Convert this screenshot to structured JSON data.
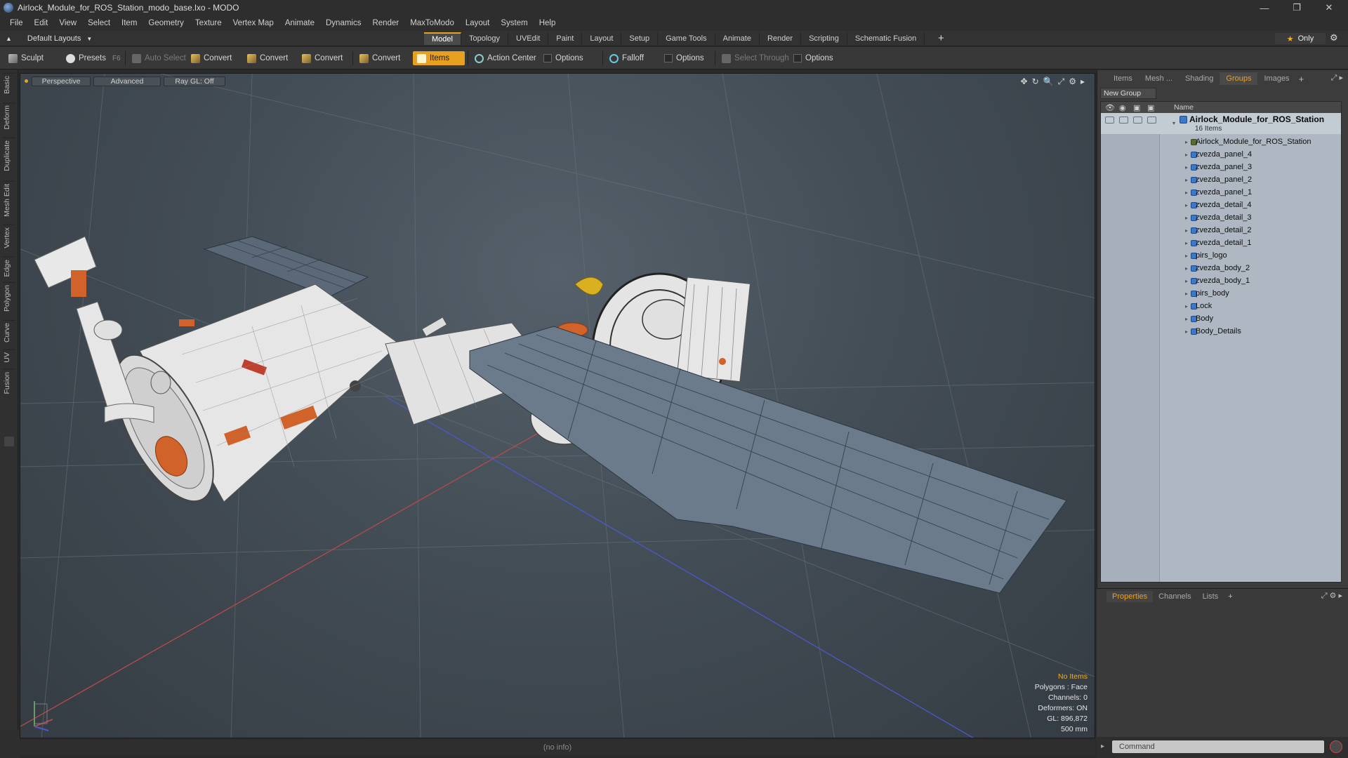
{
  "window": {
    "title": "Airlock_Module_for_ROS_Station_modo_base.lxo - MODO",
    "minimize": "—",
    "restore": "❐",
    "close": "✕"
  },
  "menu": [
    "File",
    "Edit",
    "View",
    "Select",
    "Item",
    "Geometry",
    "Texture",
    "Vertex Map",
    "Animate",
    "Dynamics",
    "Render",
    "MaxToModo",
    "Layout",
    "System",
    "Help"
  ],
  "layout": {
    "selector": "Default Layouts",
    "tabs": [
      "Model",
      "Topology",
      "UVEdit",
      "Paint",
      "Layout",
      "Setup",
      "Game Tools",
      "Animate",
      "Render",
      "Scripting",
      "Schematic Fusion"
    ],
    "active_tab": "Model",
    "add": "+",
    "only": "Only"
  },
  "toolbar": {
    "sculpt": "Sculpt",
    "presets": "Presets",
    "presets_key": "F6",
    "auto_select": "Auto Select",
    "convert1": "Convert",
    "convert2": "Convert",
    "convert3": "Convert",
    "convert4": "Convert",
    "items": "Items",
    "action_center": "Action Center",
    "options1": "Options",
    "falloff": "Falloff",
    "options2": "Options",
    "select_through": "Select Through",
    "options3": "Options"
  },
  "left_tabs": [
    "Basic",
    "Deform",
    "Duplicate",
    "Mesh Edit",
    "Vertex",
    "Edge",
    "Polygon",
    "Curve",
    "UV",
    "Fusion"
  ],
  "viewport": {
    "view": "Perspective",
    "shading": "Advanced",
    "raygl": "Ray GL: Off",
    "info": {
      "items": "No Items",
      "polygons": "Polygons : Face",
      "channels": "Channels: 0",
      "deformers": "Deformers: ON",
      "gl": "GL: 896,872",
      "scale": "500 mm"
    }
  },
  "right_panel": {
    "tabs": [
      "Items",
      "Mesh ...",
      "Shading",
      "Groups",
      "Images"
    ],
    "active_tab": "Groups",
    "add": "+",
    "new_group": "New Group",
    "column_name": "Name",
    "group": {
      "name": "Airlock_Module_for_ROS_Station",
      "count": "16 Items",
      "items": [
        "Airlock_Module_for_ROS_Station",
        "zvezda_panel_4",
        "zvezda_panel_3",
        "zvezda_panel_2",
        "zvezda_panel_1",
        "zvezda_detail_4",
        "zvezda_detail_3",
        "zvezda_detail_2",
        "zvezda_detail_1",
        "pirs_logo",
        "zvezda_body_2",
        "zvezda_body_1",
        "pirs_body",
        "Lock",
        "Body",
        "Body_Details"
      ]
    }
  },
  "properties": {
    "tabs": [
      "Properties",
      "Channels",
      "Lists"
    ],
    "active_tab": "Properties",
    "add": "+"
  },
  "status": "(no info)",
  "command": {
    "placeholder": "Command"
  },
  "colors": {
    "accent": "#e8a020",
    "groups_bg": "#afb8c2",
    "viewport_bg": "#434d56"
  }
}
